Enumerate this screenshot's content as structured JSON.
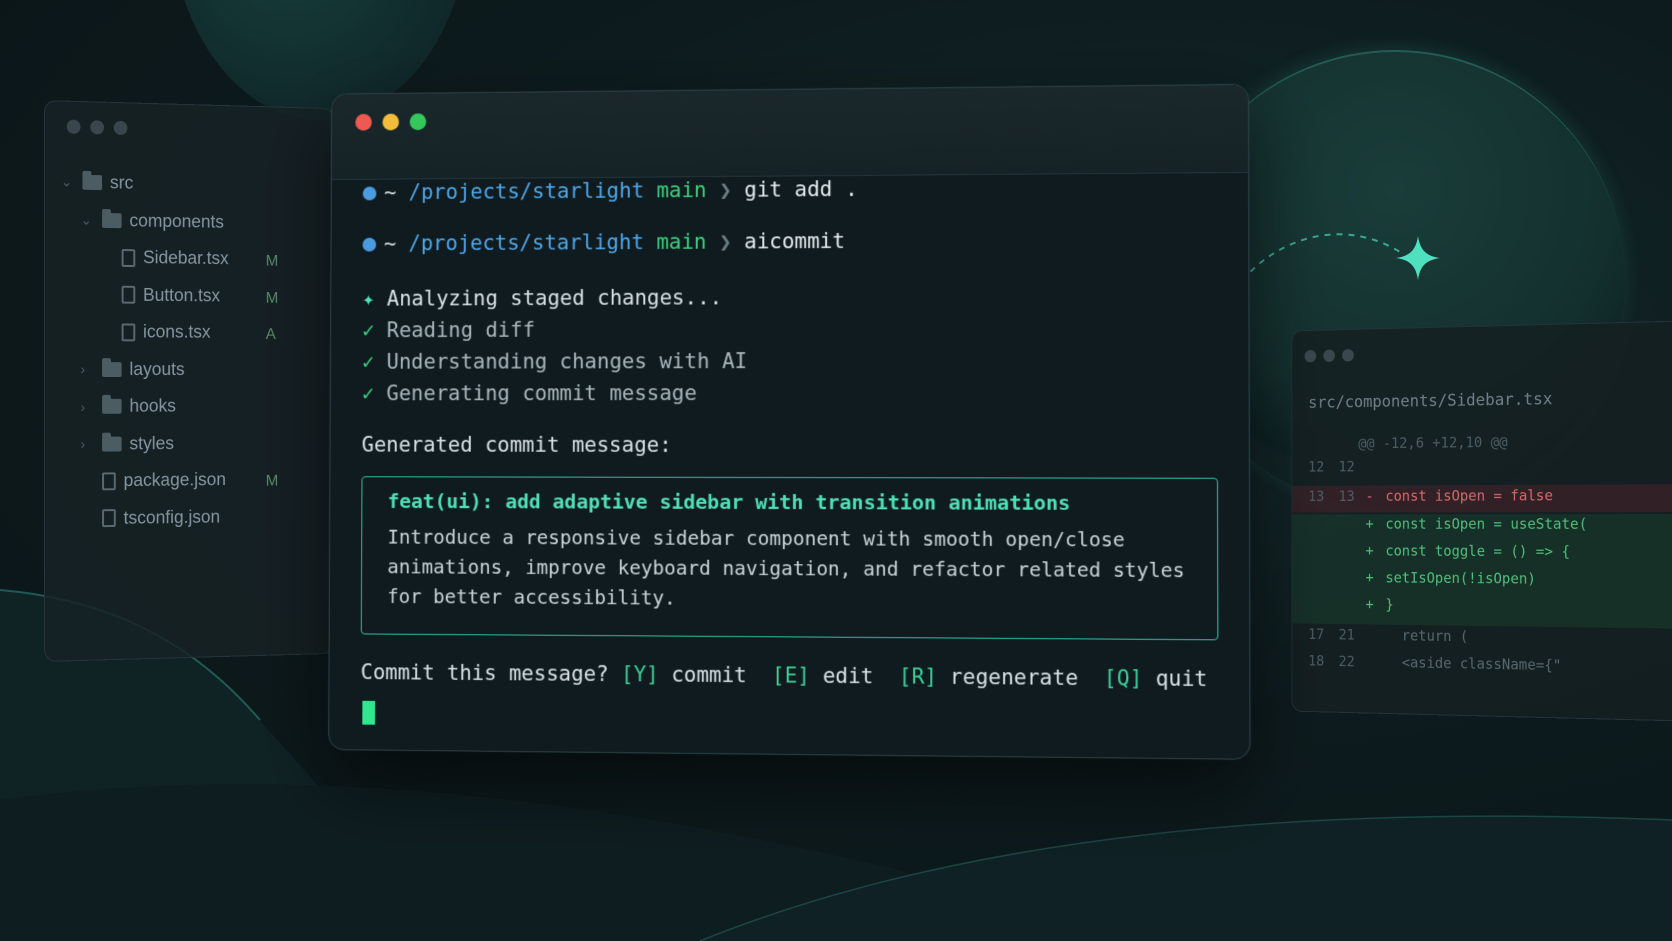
{
  "explorer": {
    "tree": [
      {
        "type": "folder",
        "label": "src",
        "depth": 0,
        "open": true
      },
      {
        "type": "folder",
        "label": "components",
        "depth": 1,
        "open": true
      },
      {
        "type": "file",
        "label": "Sidebar.tsx",
        "depth": 2,
        "badge": "M"
      },
      {
        "type": "file",
        "label": "Button.tsx",
        "depth": 2,
        "badge": "M"
      },
      {
        "type": "file",
        "label": "icons.tsx",
        "depth": 2,
        "badge": "A"
      },
      {
        "type": "folder",
        "label": "layouts",
        "depth": 1,
        "open": false
      },
      {
        "type": "folder",
        "label": "hooks",
        "depth": 1,
        "open": false
      },
      {
        "type": "folder",
        "label": "styles",
        "depth": 1,
        "open": false
      },
      {
        "type": "file",
        "label": "package.json",
        "depth": 1,
        "badge": "M"
      },
      {
        "type": "file",
        "label": "tsconfig.json",
        "depth": 1,
        "badge": ""
      }
    ]
  },
  "diff": {
    "filename": "src/components/Sidebar.tsx",
    "hunk_header": "@@ -12,6 +12,10 @@",
    "lines": [
      {
        "old": "12",
        "new": "12",
        "marker": "",
        "code": ""
      },
      {
        "old": "13",
        "new": "13",
        "marker": "-",
        "code": "const isOpen = false"
      },
      {
        "old": "",
        "new": "",
        "marker": "+",
        "code": "const isOpen = useState("
      },
      {
        "old": "",
        "new": "",
        "marker": "+",
        "code": "const toggle = () => {"
      },
      {
        "old": "",
        "new": "",
        "marker": "+",
        "code": "  setIsOpen(!isOpen)"
      },
      {
        "old": "",
        "new": "",
        "marker": "+",
        "code": "}"
      },
      {
        "old": "17",
        "new": "21",
        "marker": "",
        "code": "return ("
      },
      {
        "old": "18",
        "new": "22",
        "marker": "",
        "code": "  <aside className={\""
      }
    ]
  },
  "terminal": {
    "traffic_colors": {
      "close": "#ee5a52",
      "minimize": "#f4bc3b",
      "maximize": "#34c759"
    },
    "prompts": [
      {
        "tilde": "~",
        "path": "/projects/starlight",
        "branch": "main",
        "arrow": "❯",
        "command": "git add ."
      },
      {
        "tilde": "~",
        "path": "/projects/starlight",
        "branch": "main",
        "arrow": "❯",
        "command": "aicommit"
      }
    ],
    "steps": [
      {
        "icon": "sparkle-icon",
        "glyph": "✦",
        "text": "Analyzing staged changes..."
      },
      {
        "icon": "check-icon",
        "glyph": "✓",
        "text": "Reading diff"
      },
      {
        "icon": "check-icon",
        "glyph": "✓",
        "text": "Understanding changes with AI"
      },
      {
        "icon": "check-icon",
        "glyph": "✓",
        "text": "Generating commit message"
      }
    ],
    "generated_label": "Generated commit message:",
    "commit_title": "feat(ui): add adaptive sidebar with transition animations",
    "commit_body": [
      "Introduce a responsive sidebar component with smooth open/close",
      "animations, improve keyboard navigation, and refactor related styles",
      "for better accessibility."
    ],
    "confirm_question": "Commit this message?",
    "options": [
      {
        "key": "[Y]",
        "label": "commit"
      },
      {
        "key": "[E]",
        "label": "edit"
      },
      {
        "key": "[R]",
        "label": "regenerate"
      },
      {
        "key": "[Q]",
        "label": "quit"
      }
    ]
  },
  "colors": {
    "accent": "#4fe0b8",
    "branch": "#3ecf7e",
    "path": "#4fa8ea",
    "cursor": "#2ee88f"
  }
}
